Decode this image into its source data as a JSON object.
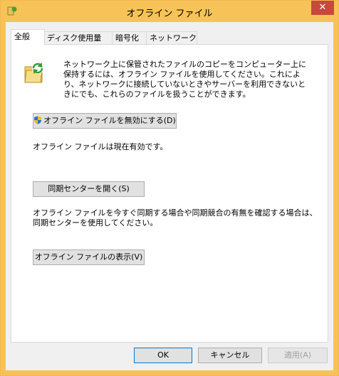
{
  "window": {
    "title": "オフライン ファイル",
    "close_label": "✕",
    "accent": "#f7c358"
  },
  "tabs": [
    {
      "label": "全般",
      "active": true
    },
    {
      "label": "ディスク使用量",
      "active": false
    },
    {
      "label": "暗号化",
      "active": false
    },
    {
      "label": "ネットワーク",
      "active": false
    }
  ],
  "general": {
    "description": "ネットワーク上に保管されたファイルのコピーをコンピューター上に保持するには、オフライン ファイルを使用してください。これにより、ネットワークに接続していないときやサーバーを利用できないときにでも、これらのファイルを扱うことができます。",
    "disable_button": "オフライン ファイルを無効にする(D)",
    "status_text": "オフライン ファイルは現在有効です。",
    "sync_center_button": "同期センターを開く(S)",
    "sync_description": "オフライン ファイルを今すぐ同期する場合や同期競合の有無を確認する場合は、同期センターを使用してください。",
    "view_button": "オフライン ファイルの表示(V)"
  },
  "footer": {
    "ok": "OK",
    "cancel": "キャンセル",
    "apply": "適用(A)"
  }
}
